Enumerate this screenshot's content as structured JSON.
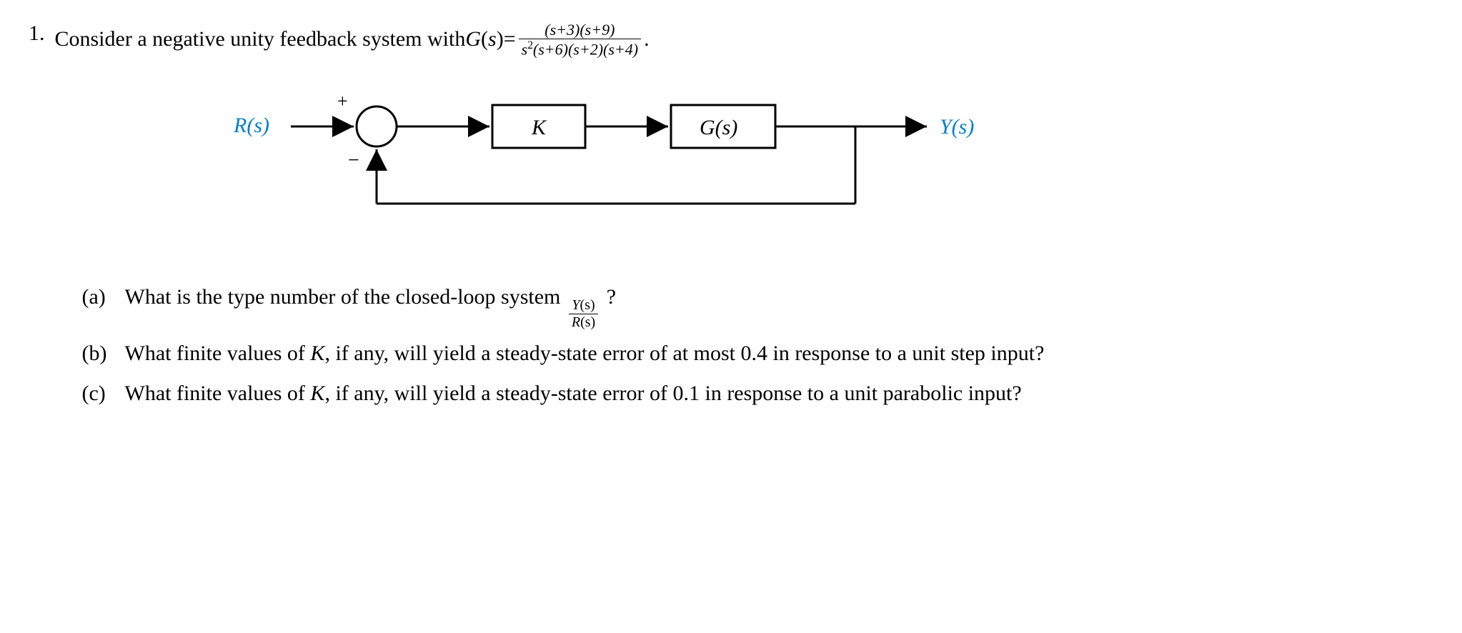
{
  "problem": {
    "number": "1.",
    "intro_prefix": "Consider a negative unity feedback system with ",
    "G_label": "G",
    "s_label": "s",
    "equals": " = ",
    "tf_numer": "(s+3)(s+9)",
    "tf_denom_a": "s",
    "tf_denom_b": "(s+6)(s+2)(s+4)",
    "period": "."
  },
  "diagram": {
    "R": "R(s)",
    "K": "K",
    "G": "G(s)",
    "Y": "Y(s)",
    "plus": "+",
    "minus": "−"
  },
  "parts": {
    "a": {
      "label": "(a)",
      "text_before": "What is the type number of the closed-loop system ",
      "frac_top_a": "Y",
      "frac_top_b": "(s)",
      "frac_bot_a": "R",
      "frac_bot_b": "(s)",
      "text_after": "?"
    },
    "b": {
      "label": "(b)",
      "text": "What finite values of K, if any, will yield a steady-state error of at most 0.4 in response to a unit step input?"
    },
    "c": {
      "label": "(c)",
      "text": "What finite values of K, if any, will yield a steady-state error of 0.1 in response to a unit parabolic input?"
    }
  }
}
